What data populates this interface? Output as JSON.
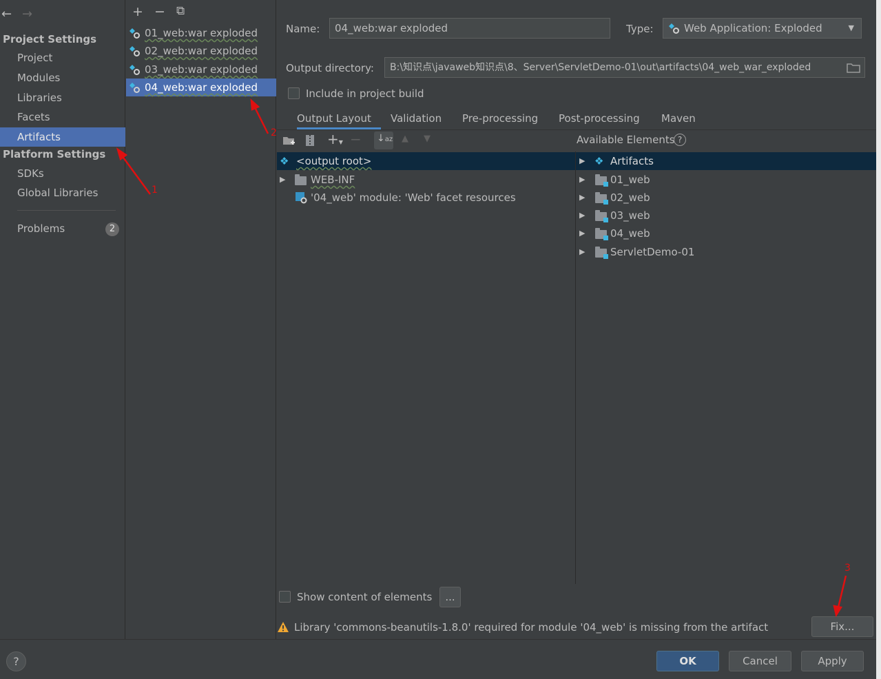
{
  "nav": {
    "back_icon": "back-arrow-icon",
    "forward_icon": "forward-arrow-icon",
    "project_settings_header": "Project Settings",
    "project_items": [
      "Project",
      "Modules",
      "Libraries",
      "Facets",
      "Artifacts"
    ],
    "platform_settings_header": "Platform Settings",
    "platform_items": [
      "SDKs",
      "Global Libraries"
    ],
    "problems_label": "Problems",
    "problems_count": "2"
  },
  "artifacts": {
    "toolbar": [
      "+",
      "−",
      "⧉"
    ],
    "items": [
      "01_web:war exploded",
      "02_web:war exploded",
      "03_web:war exploded",
      "04_web:war exploded"
    ]
  },
  "detail": {
    "name_label": "Name:",
    "name_value": "04_web:war exploded",
    "type_label": "Type:",
    "type_value": "Web Application: Exploded",
    "output_dir_label": "Output directory:",
    "output_dir_value": "B:\\知识点\\javaweb知识点\\8、Server\\ServletDemo-01\\out\\artifacts\\04_web_war_exploded",
    "include_build_label": "Include in project build",
    "tabs": [
      "Output Layout",
      "Validation",
      "Pre-processing",
      "Post-processing",
      "Maven"
    ],
    "available_label": "Available Elements",
    "layout_tree": {
      "root": "<output root>",
      "web_inf": "WEB-INF",
      "facet": "'04_web' module: 'Web' facet resources"
    },
    "available_tree": [
      "Artifacts",
      "01_web",
      "02_web",
      "03_web",
      "04_web",
      "ServletDemo-01"
    ],
    "show_content_label": "Show content of elements",
    "ellipsis_button": "...",
    "warning_text": "Library 'commons-beanutils-1.8.0' required for module '04_web' is missing from the artifact",
    "fix_button": "Fix..."
  },
  "footer": {
    "help": "?",
    "ok": "OK",
    "cancel": "Cancel",
    "apply": "Apply"
  },
  "annotations": [
    "1",
    "2",
    "3"
  ],
  "colors": {
    "background": "#3c3f41",
    "selection": "#4b6eaf",
    "tree_selection": "#0d293e",
    "accent": "#40b6e0",
    "annotation": "#e01010",
    "warning": "#f0a732"
  }
}
